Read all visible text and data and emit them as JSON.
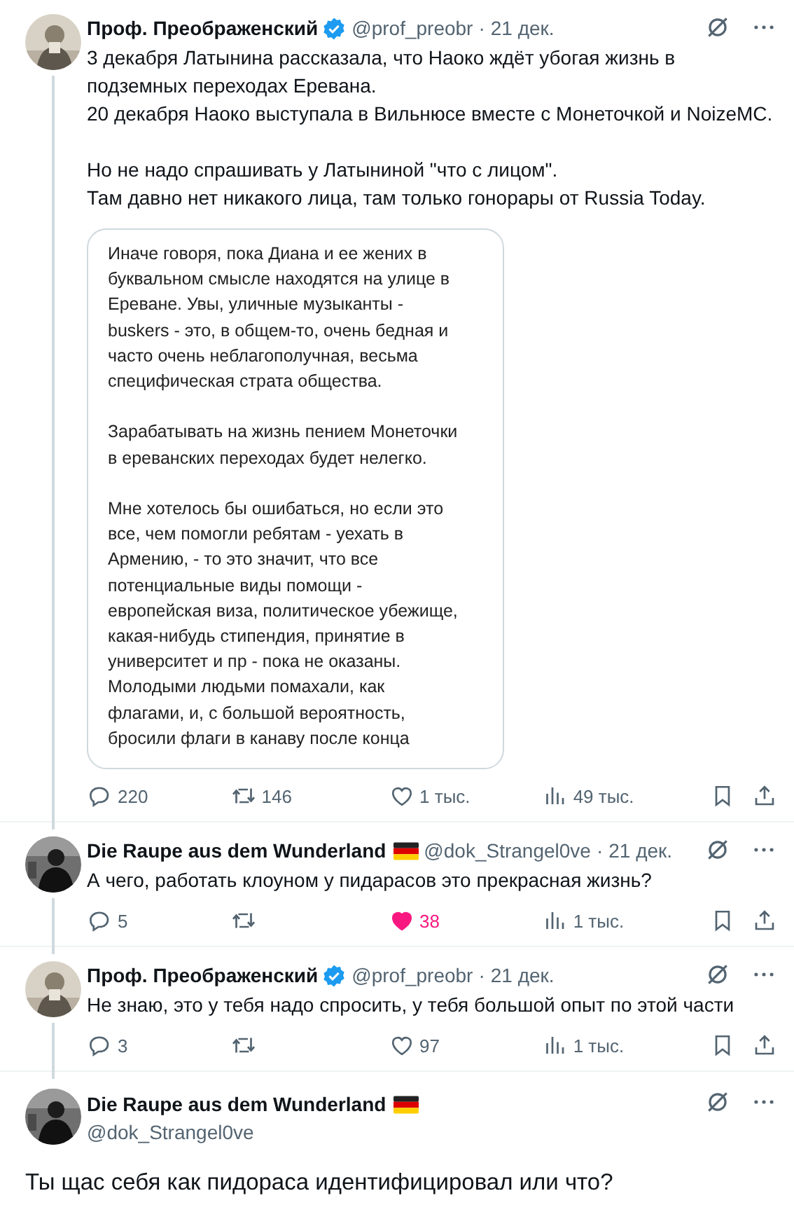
{
  "tweets": [
    {
      "kind": "compact",
      "thread_line": true,
      "author": {
        "name": "Проф. Преображенский",
        "verified": true,
        "flag": false,
        "handle": "@prof_preobr"
      },
      "separator": "·",
      "date": "21 дек.",
      "paragraphs": [
        [
          "3 декабря Латынина рассказала, что Наоко ждёт убогая жизнь в",
          "подземных переходах Еревана.",
          "20 декабря Наоко выступала в Вильнюсе вместе с Монеточкой и NoizeMC."
        ],
        [
          "Но не надо спрашивать у Латыниной \"что с лицом\".",
          "Там давно нет никакого лица, там только гонорары от Russia Today."
        ]
      ],
      "quote_card": {
        "paragraphs": [
          [
            "Иначе говоря, пока Диана и ее жених в",
            "буквальном смысле находятся на улице в",
            "Ереване. Увы, уличные музыканты -",
            "buskers - это, в общем-то, очень бедная и",
            "часто очень неблагополучная, весьма",
            "специфическая страта общества."
          ],
          [
            "Зарабатывать на жизнь пением Монеточки",
            "в ереванских переходах будет нелегко."
          ],
          [
            "Мне хотелось бы ошибаться, но если это",
            "все, чем помогли ребятам - уехать в",
            "Армению, - то это значит, что все",
            "потенциальные виды помощи -",
            "европейская виза, политическое убежище,",
            "какая-нибудь стипендия, принятие в",
            "университет и пр - пока не оказаны.",
            "Молодыми людьми помахали, как",
            "флагами, и, с большой вероятность,",
            "бросили флаги в канаву после конца"
          ]
        ]
      },
      "stats": {
        "replies": "220",
        "reposts": "146",
        "likes": "1 тыс.",
        "views": "49 тыс.",
        "liked": false
      }
    },
    {
      "kind": "compact",
      "thread_line": true,
      "author": {
        "name": "Die Raupe aus dem Wunderland",
        "verified": false,
        "flag": true,
        "handle": "@dok_Strangel0ve"
      },
      "separator": "·",
      "date": "21 дек.",
      "paragraphs": [
        [
          "А чего, работать клоуном у пидарасов это прекрасная жизнь?"
        ]
      ],
      "stats": {
        "replies": "5",
        "likes": "38",
        "views": "1 тыс.",
        "liked": true
      }
    },
    {
      "kind": "compact",
      "thread_line": true,
      "author": {
        "name": "Проф. Преображенский",
        "verified": true,
        "flag": false,
        "handle": "@prof_preobr"
      },
      "separator": "·",
      "date": "21 дек.",
      "paragraphs": [
        [
          "Не знаю, это у тебя надо спросить, у тебя большой опыт по этой части"
        ]
      ],
      "stats": {
        "replies": "3",
        "likes": "97",
        "views": "1 тыс.",
        "liked": false
      }
    },
    {
      "kind": "focused",
      "thread_line": false,
      "author": {
        "name": "Die Raupe aus dem Wunderland",
        "verified": false,
        "flag": true,
        "handle": "@dok_Strangel0ve"
      },
      "paragraphs": [
        [
          "Ты щас себя как пидораса идентифицировал или что?"
        ]
      ]
    }
  ]
}
